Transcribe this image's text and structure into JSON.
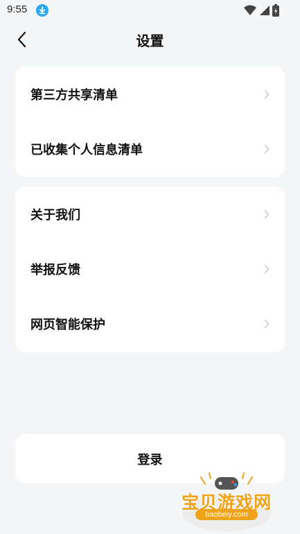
{
  "status_bar": {
    "time": "9:55",
    "icons": [
      "download-icon",
      "wifi-icon",
      "signal-icon",
      "battery-icon"
    ]
  },
  "header": {
    "back_icon": "chevron-left-icon",
    "title": "设置"
  },
  "sections": [
    {
      "items": [
        {
          "label": "第三方共享清单"
        },
        {
          "label": "已收集个人信息清单"
        }
      ]
    },
    {
      "items": [
        {
          "label": "关于我们"
        },
        {
          "label": "举报反馈"
        },
        {
          "label": "网页智能保护"
        }
      ]
    }
  ],
  "login_button": {
    "label": "登录"
  },
  "watermark": {
    "brand": "宝贝游戏网",
    "url": "baobeiy.com"
  },
  "colors": {
    "background": "#f4f5f7",
    "card": "#ffffff",
    "accent": "#2aa6f5",
    "watermark": "#f0a21a"
  }
}
